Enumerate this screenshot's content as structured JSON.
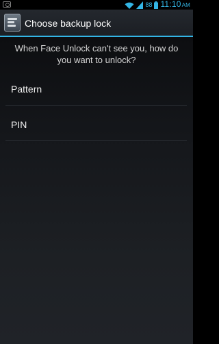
{
  "status_bar": {
    "battery": "88",
    "time": "11:10",
    "ampm": "AM",
    "accent_color": "#33b5e5",
    "icons": [
      "screenshot-icon",
      "wifi-icon",
      "signal-icon",
      "battery-icon"
    ]
  },
  "action_bar": {
    "title": "Choose backup lock",
    "icon": "settings-app-icon"
  },
  "content": {
    "prompt": "When Face Unlock can't see you, how do you want to unlock?",
    "options": [
      {
        "label": "Pattern"
      },
      {
        "label": "PIN"
      }
    ]
  }
}
